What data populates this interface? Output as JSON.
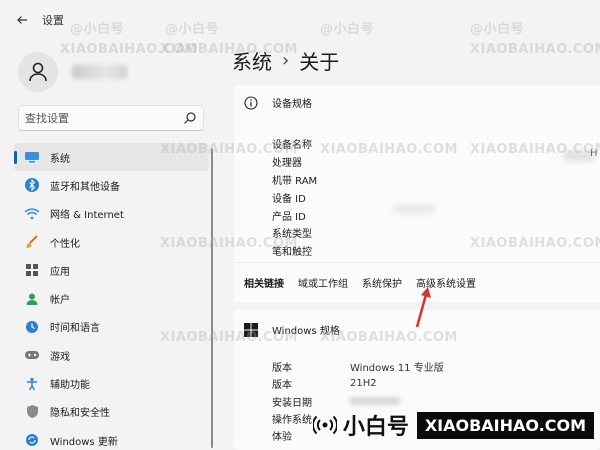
{
  "app": {
    "title": "设置"
  },
  "sidebar": {
    "search_placeholder": "查找设置",
    "items": [
      {
        "label": "系统",
        "icon": "monitor-icon",
        "active": true
      },
      {
        "label": "蓝牙和其他设备",
        "icon": "bluetooth-icon"
      },
      {
        "label": "网络 & Internet",
        "icon": "wifi-icon"
      },
      {
        "label": "个性化",
        "icon": "brush-icon"
      },
      {
        "label": "应用",
        "icon": "apps-icon"
      },
      {
        "label": "帐户",
        "icon": "account-icon"
      },
      {
        "label": "时间和语言",
        "icon": "clock-globe-icon"
      },
      {
        "label": "游戏",
        "icon": "gamepad-icon"
      },
      {
        "label": "辅助功能",
        "icon": "accessibility-icon"
      },
      {
        "label": "隐私和安全性",
        "icon": "shield-icon"
      },
      {
        "label": "Windows 更新",
        "icon": "update-icon"
      }
    ]
  },
  "main": {
    "breadcrumb": [
      "系统",
      "关于"
    ],
    "device_spec": {
      "title": "设备规格",
      "rows": [
        "设备名称",
        "处理器",
        "机带 RAM",
        "设备 ID",
        "产品 ID",
        "系统类型",
        "笔和触控"
      ],
      "processor_value_partial": "H"
    },
    "related": {
      "title": "相关链接",
      "links": [
        "域或工作组",
        "系统保护",
        "高级系统设置"
      ]
    },
    "windows_spec": {
      "title": "Windows 规格",
      "rows": [
        {
          "key": "版本",
          "value": "Windows 11 专业版"
        },
        {
          "key": "版本",
          "value": "21H2"
        },
        {
          "key": "安装日期",
          "value": ""
        },
        {
          "key": "操作系统",
          "value": ""
        },
        {
          "key": "体验",
          "value": ""
        }
      ]
    }
  },
  "watermark": {
    "tile_text": "@小白号",
    "tile_site": "XIAOBAIHAO.COM",
    "logo_text": "小白号",
    "site": "XIAOBAIHAO.COM"
  },
  "colors": {
    "accent": "#0067c0",
    "annotation_arrow": "#d9342b"
  }
}
